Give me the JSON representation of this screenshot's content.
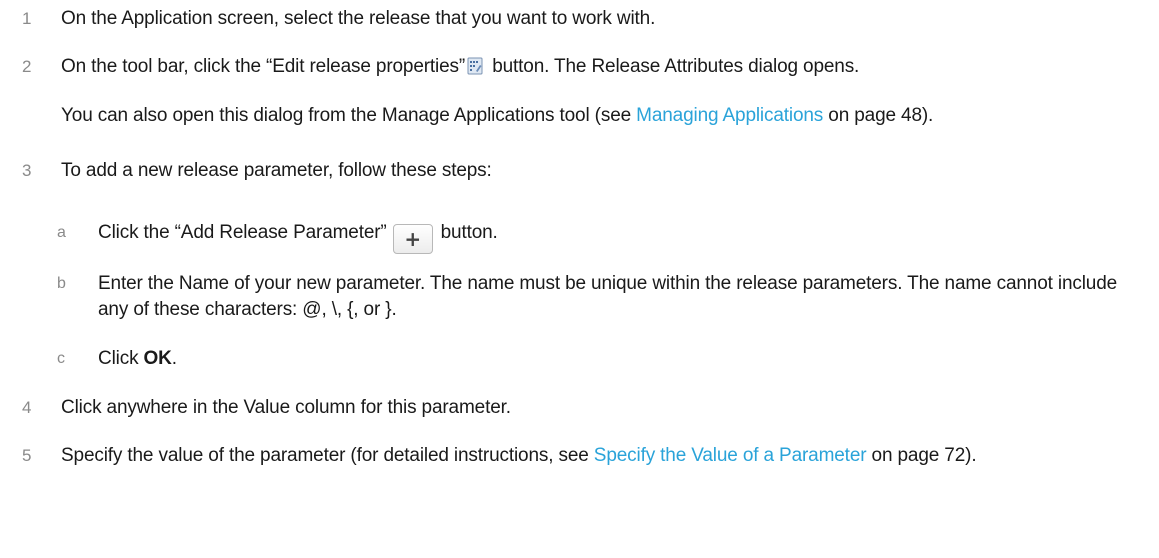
{
  "steps": [
    {
      "num": "1",
      "text": "On the Application screen, select the release that you want to work with."
    },
    {
      "num": "2",
      "before": "On the tool bar, click the “Edit release properties”",
      "icon": "edit-properties-icon",
      "after": " button. The Release Attributes dialog opens.",
      "para2_before": "You can also open this dialog from the Manage Applications tool (see ",
      "para2_link": "Managing Applications",
      "para2_after": " on page 48)."
    },
    {
      "num": "3",
      "text": "To add a new release parameter, follow these steps:",
      "substeps": [
        {
          "letter": "a",
          "before": "Click the “Add Release Parameter”",
          "button_glyph": "+",
          "after": "button."
        },
        {
          "letter": "b",
          "text": "Enter the Name of your new parameter. The name must be unique within the release parameters. The name cannot include any of these characters: @, \\, {, or }."
        },
        {
          "letter": "c",
          "before": "Click ",
          "bold": "OK",
          "after": "."
        }
      ]
    },
    {
      "num": "4",
      "text": "Click anywhere in the Value column for this parameter."
    },
    {
      "num": "5",
      "before": "Specify the value of the parameter (for detailed instructions, see ",
      "link": "Specify the Value of a Parameter",
      "after": " on page 72)."
    }
  ],
  "colors": {
    "link": "#2aa3d9",
    "number": "#8a8a8a",
    "text": "#1a1a1a"
  }
}
